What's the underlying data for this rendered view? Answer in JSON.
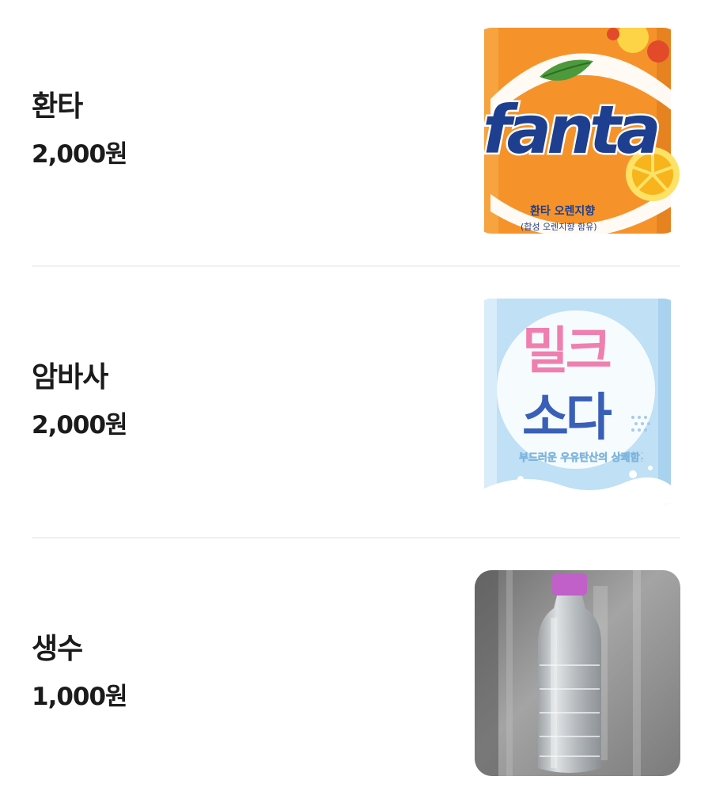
{
  "menu": {
    "items": [
      {
        "name": "환타",
        "price": "2,000원",
        "image": {
          "subject": "Fanta orange can",
          "logo_text": "fanta",
          "label_line1": "환타 오렌지향",
          "label_line2": "(합성 오렌지향 함유)",
          "colors": {
            "base": "#f5932a",
            "logo": "#1e3f8f",
            "leaf": "#4c9a3b"
          }
        }
      },
      {
        "name": "암바사",
        "price": "2,000원",
        "image": {
          "subject": "Milk soda can",
          "title_top": "밀크",
          "title_bottom": "소다",
          "tagline": "부드러운 우유탄산의 상쾌함!",
          "colors": {
            "base": "#bfe0f5",
            "pink": "#ef7fae",
            "blue": "#3a5fb8"
          }
        }
      },
      {
        "name": "생수",
        "price": "1,000원",
        "image": {
          "subject": "Bottled water",
          "colors": {
            "background": "#8a8a8a",
            "cap": "#c060c8"
          }
        }
      }
    ]
  }
}
